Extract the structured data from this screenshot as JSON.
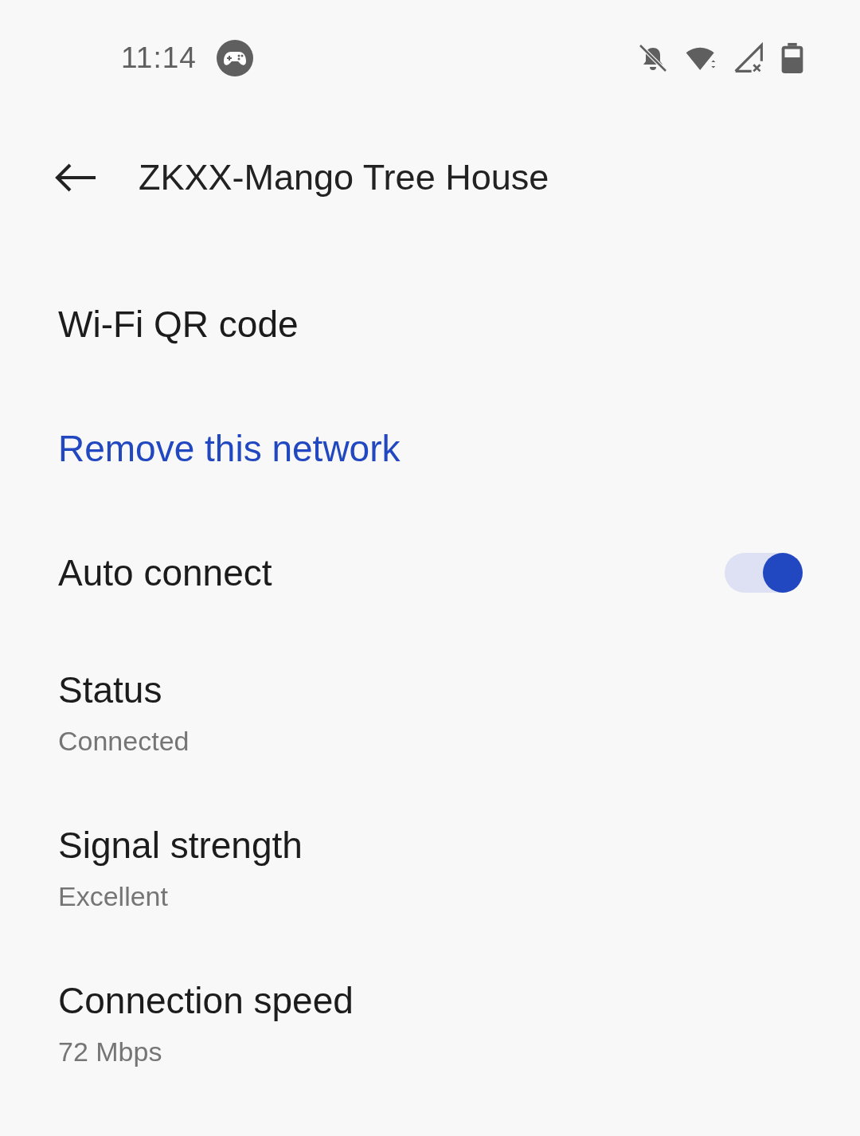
{
  "status_bar": {
    "time": "11:14"
  },
  "header": {
    "title": "ZKXX-Mango Tree House"
  },
  "items": [
    {
      "kind": "plain",
      "title": "Wi-Fi QR code"
    },
    {
      "kind": "link",
      "title": "Remove this network"
    },
    {
      "kind": "toggle",
      "title": "Auto connect",
      "on": true
    },
    {
      "kind": "detail",
      "title": "Status",
      "value": "Connected"
    },
    {
      "kind": "detail",
      "title": "Signal strength",
      "value": "Excellent"
    },
    {
      "kind": "detail",
      "title": "Connection speed",
      "value": "72 Mbps"
    }
  ]
}
